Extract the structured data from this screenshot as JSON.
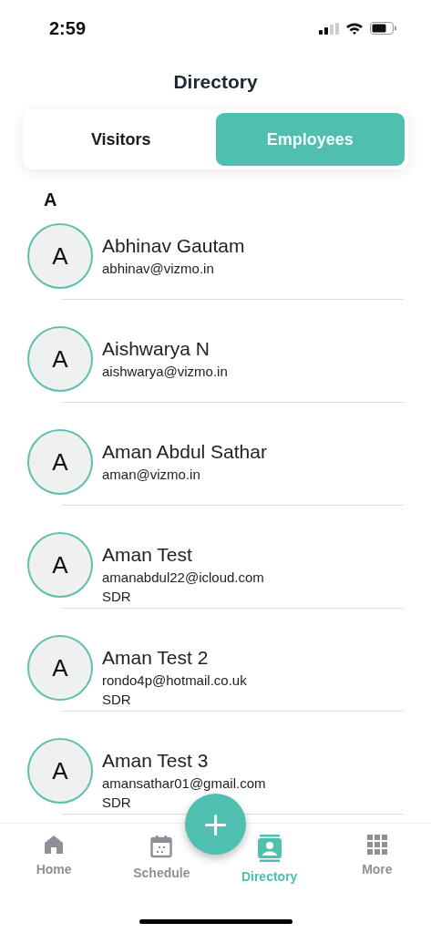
{
  "status_bar": {
    "time": "2:59"
  },
  "title": "Directory",
  "tabs": [
    {
      "label": "Visitors",
      "selected": false
    },
    {
      "label": "Employees",
      "selected": true
    }
  ],
  "section_letter": "A",
  "employees": [
    {
      "initial": "A",
      "name": "Abhinav Gautam",
      "email": "abhinav@vizmo.in"
    },
    {
      "initial": "A",
      "name": "Aishwarya N",
      "email": "aishwarya@vizmo.in"
    },
    {
      "initial": "A",
      "name": "Aman Abdul Sathar",
      "email": "aman@vizmo.in"
    },
    {
      "initial": "A",
      "name": "Aman Test",
      "email": "amanabdul22@icloud.com",
      "role": "SDR"
    },
    {
      "initial": "A",
      "name": "Aman Test 2",
      "email": "rondo4p@hotmail.co.uk",
      "role": "SDR"
    },
    {
      "initial": "A",
      "name": "Aman Test 3",
      "email": "amansathar01@gmail.com",
      "role": "SDR"
    }
  ],
  "fab": {
    "label": "+"
  },
  "nav": [
    {
      "kind": "home",
      "label": "Home",
      "selected": false
    },
    {
      "kind": "schedule",
      "label": "Schedule",
      "selected": false
    },
    {
      "kind": "directory",
      "label": "Directory",
      "selected": true
    },
    {
      "kind": "more",
      "label": "More",
      "selected": false
    }
  ]
}
